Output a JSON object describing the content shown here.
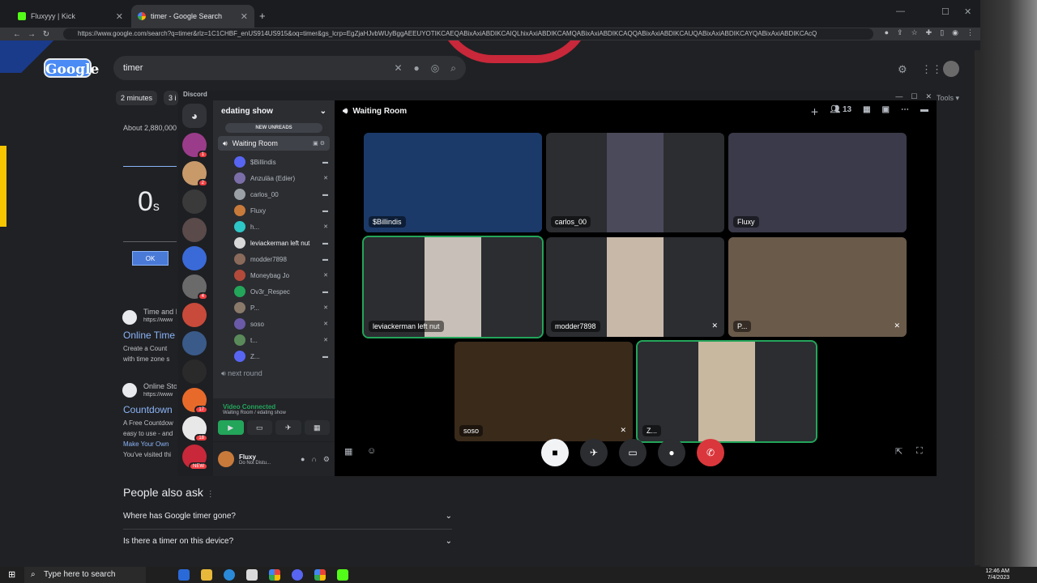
{
  "browser": {
    "tabs": [
      {
        "label": "Fluxyyy | Kick"
      },
      {
        "label": "timer - Google Search"
      }
    ],
    "url": "https://www.google.com/search?q=timer&rlz=1C1CHBF_enUS914US915&oq=timer&gs_lcrp=EgZjaHJvbWUyBggAEEUYOTIKCAEQABixAxiABDIKCAIQLhixAxiABDIKCAMQABixAxiABDIKCAQQABixAxiABDIKCAUQABixAxiABDIKCAYQABixAxiABDIKCAcQ"
  },
  "google": {
    "logo": "Google",
    "query": "timer",
    "chips": [
      "2 minutes",
      "3 i"
    ],
    "tools": "Tools",
    "about": "About 2,880,000",
    "timer_value": "0",
    "timer_unit": "s",
    "ok": "OK",
    "result1_title": "Time and I",
    "result1_url": "https://www",
    "result1_link": "Online Time",
    "result1_desc1": "Create a Count",
    "result1_desc2": "with time zone s",
    "result2_title": "Online Sto",
    "result2_url": "https://www",
    "result2_link": "Countdown",
    "result2_desc1": "A Free Countdow",
    "result2_desc2": "easy to use - and",
    "result2_desc3": "Make Your Own",
    "result2_desc4": "You've visited thi",
    "people_also_ask": "People also ask",
    "questions": [
      "Where has Google timer gone?",
      "Is there a timer on this device?"
    ]
  },
  "discord": {
    "app_title": "Discord",
    "server_name": "edating show",
    "new_unreads": "NEW UNREADS",
    "voice_channel": "Waiting Room",
    "members": [
      {
        "name": "$Billindis",
        "color": "#5865f2"
      },
      {
        "name": "Anzuläa (Edier)",
        "color": "#7b6ea8"
      },
      {
        "name": "carlos_00",
        "color": "#9aa0a6"
      },
      {
        "name": "Fluxy",
        "color": "#c87a3a"
      },
      {
        "name": "h...",
        "color": "#2dc7c7"
      },
      {
        "name": "leviackerman left nut",
        "color": "#d8d8d8"
      },
      {
        "name": "modder7898",
        "color": "#8a6a5a"
      },
      {
        "name": "Moneybag Jo",
        "color": "#b44a3a"
      },
      {
        "name": "Ov3r_Respec",
        "color": "#23a55a"
      },
      {
        "name": "P...",
        "color": "#8a7a6a"
      },
      {
        "name": "soso",
        "color": "#6a5aa8"
      },
      {
        "name": "t...",
        "color": "#5a8a5a"
      },
      {
        "name": "Z...",
        "color": "#5865f2"
      }
    ],
    "next_channel": "next round",
    "voice_status": "Video Connected",
    "voice_sub": "Waiting Room / edating show",
    "user_name": "Fluxy",
    "user_status": "Do Not Distu...",
    "stage_title": "Waiting Room",
    "participant_count": "13",
    "tiles": [
      {
        "label": "$Billindis"
      },
      {
        "label": "carlos_00"
      },
      {
        "label": "Fluxy"
      },
      {
        "label": "leviackerman left nut"
      },
      {
        "label": "modder7898"
      },
      {
        "label": "P..."
      },
      {
        "label": "soso"
      },
      {
        "label": "Z..."
      }
    ],
    "guild_badges": [
      "1",
      "2",
      "4",
      "17",
      "18",
      "NEW"
    ]
  },
  "taskbar": {
    "search": "Type here to search",
    "time": "12:46 AM",
    "date": "7/4/2023"
  }
}
